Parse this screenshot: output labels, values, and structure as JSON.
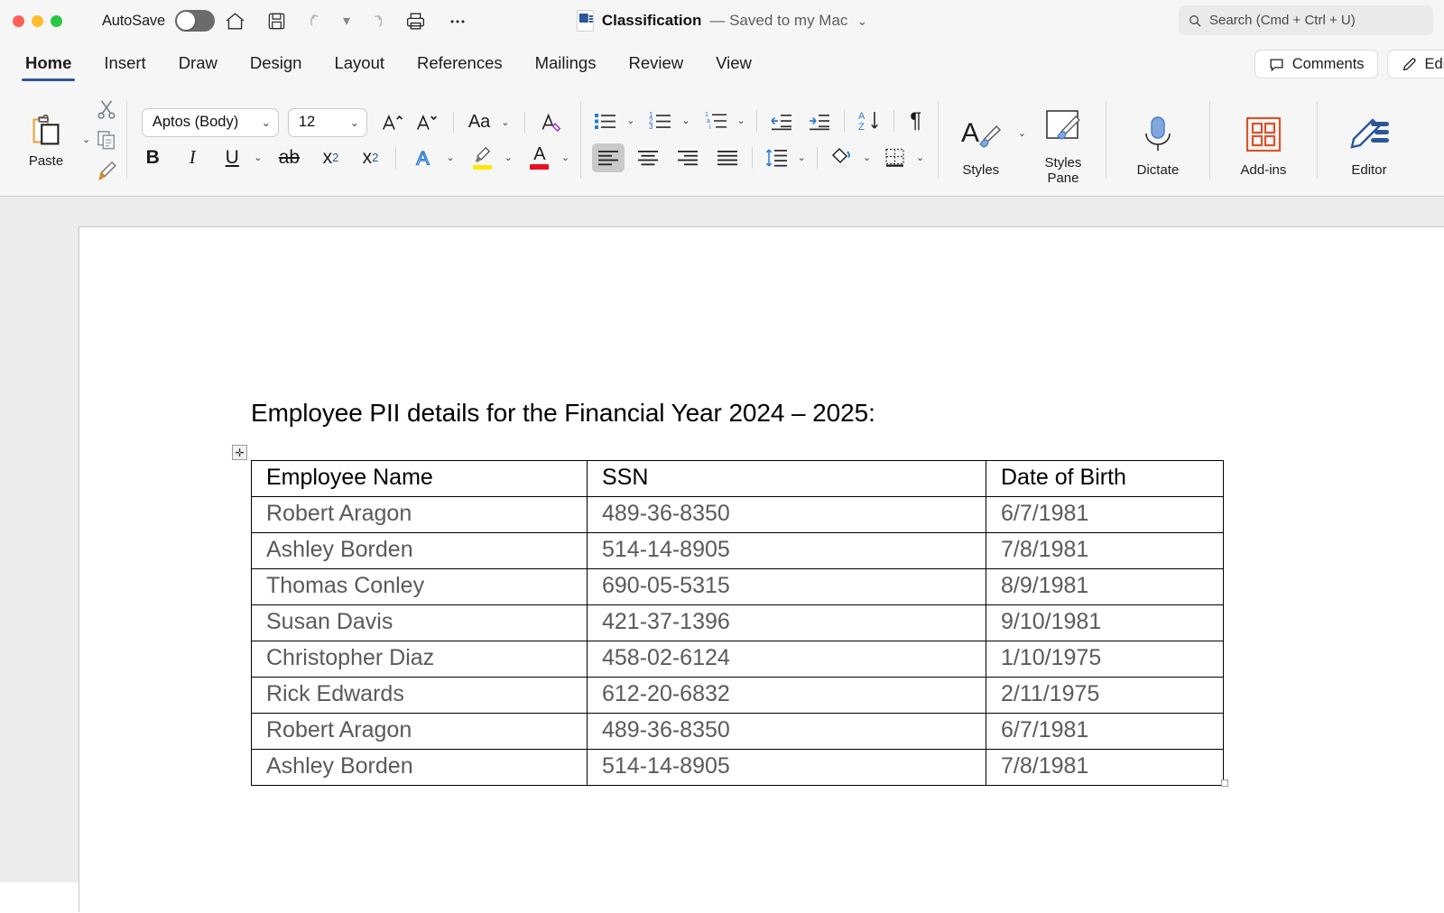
{
  "window": {
    "traffic_lights": [
      "close",
      "minimize",
      "maximize"
    ],
    "autosave_label": "AutoSave",
    "autosave_state": "off",
    "quick_access": [
      {
        "name": "home-icon",
        "label": "Home"
      },
      {
        "name": "save-icon",
        "label": "Save"
      },
      {
        "name": "undo-icon",
        "label": "Undo"
      },
      {
        "name": "redo-icon",
        "label": "Redo"
      },
      {
        "name": "print-icon",
        "label": "Print"
      },
      {
        "name": "more-icon",
        "label": "More"
      }
    ],
    "document_name": "Classification",
    "save_status": "— Saved to my Mac",
    "search_placeholder": "Search (Cmd + Ctrl + U)"
  },
  "tabs": [
    {
      "label": "Home",
      "active": true
    },
    {
      "label": "Insert",
      "active": false
    },
    {
      "label": "Draw",
      "active": false
    },
    {
      "label": "Design",
      "active": false
    },
    {
      "label": "Layout",
      "active": false
    },
    {
      "label": "References",
      "active": false
    },
    {
      "label": "Mailings",
      "active": false
    },
    {
      "label": "Review",
      "active": false
    },
    {
      "label": "View",
      "active": false
    }
  ],
  "tab_actions": [
    {
      "label": "Comments",
      "icon": "comment-icon"
    },
    {
      "label": "Editing",
      "icon": "pencil-icon"
    }
  ],
  "ribbon": {
    "clipboard": {
      "paste_label": "Paste",
      "cut_label": "Cut",
      "copy_label": "Copy",
      "format_painter_label": "Format Painter"
    },
    "font": {
      "font_family_value": "Aptos (Body)",
      "font_size_value": "12",
      "grow_font_label": "Grow Font",
      "shrink_font_label": "Shrink Font",
      "change_case_label": "Aa",
      "clear_formatting_label": "Clear All Formatting",
      "bold_label": "B",
      "italic_label": "I",
      "underline_label": "U",
      "strikethrough_label": "ab",
      "subscript_label": "x",
      "subscript_sub": "2",
      "superscript_label": "x",
      "superscript_sup": "2",
      "text_effects_label": "A",
      "highlight_label": "Text Highlight Color",
      "font_color_label": "A",
      "highlight_color": "#ffe800",
      "font_color_swatch": "#e81123"
    },
    "paragraph": {
      "bullets_label": "Bullets",
      "numbering_label": "Numbering",
      "multilevel_label": "Multilevel List",
      "decrease_indent_label": "Decrease Indent",
      "increase_indent_label": "Increase Indent",
      "sort_label": "Sort",
      "show_marks_label": "¶",
      "align_left_label": "Align Left",
      "align_center_label": "Center",
      "align_right_label": "Align Right",
      "justify_label": "Justify",
      "line_spacing_label": "Line and Paragraph Spacing",
      "shading_label": "Shading",
      "borders_label": "Borders"
    },
    "styles": [
      {
        "label": "Styles",
        "icon": "styles-icon"
      },
      {
        "label": "Styles\nPane",
        "label_line1": "Styles",
        "label_line2": "Pane",
        "icon": "styles-pane-icon"
      }
    ],
    "voice": {
      "label": "Dictate",
      "icon": "microphone-icon"
    },
    "addins": {
      "label": "Add-ins",
      "icon": "addins-icon",
      "color": "#d9542b"
    },
    "editor": {
      "label": "Editor",
      "icon": "editor-icon",
      "color": "#2b579a"
    }
  },
  "document": {
    "heading": "Employee PII details for the Financial Year 2024 – 2025:",
    "table": {
      "columns": [
        "Employee Name",
        "SSN",
        "Date of Birth"
      ],
      "rows": [
        [
          "Robert Aragon",
          "489-36-8350",
          "6/7/1981"
        ],
        [
          "Ashley Borden",
          "514-14-8905",
          "7/8/1981"
        ],
        [
          "Thomas Conley",
          "690-05-5315",
          "8/9/1981"
        ],
        [
          "Susan Davis",
          "421-37-1396",
          "9/10/1981"
        ],
        [
          "Christopher Diaz",
          "458-02-6124",
          "1/10/1975"
        ],
        [
          "Rick Edwards",
          "612-20-6832",
          "2/11/1975"
        ],
        [
          "Robert Aragon",
          "489-36-8350",
          "6/7/1981"
        ],
        [
          "Ashley Borden",
          "514-14-8905",
          "7/8/1981"
        ]
      ]
    },
    "table_move_handle": "✛",
    "table_resize_handle": "resize"
  },
  "colors": {
    "accent": "#2b579a",
    "ribbon_bg": "#f6f6f6",
    "canvas_bg": "#ececec",
    "page_bg": "#ffffff"
  }
}
